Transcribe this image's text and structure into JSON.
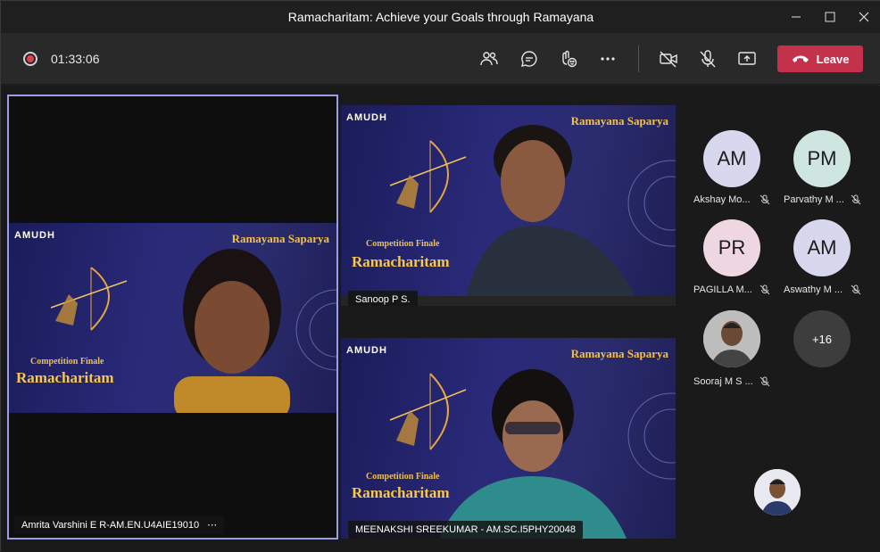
{
  "window": {
    "title": "Ramacharitam: Achieve your Goals through Ramayana"
  },
  "toolbar": {
    "recording_time": "01:33:06",
    "leave_label": "Leave",
    "colors": {
      "leave": "#c4314b",
      "record": "#e0404f"
    }
  },
  "stage": {
    "videos": [
      {
        "participant": "Amrita Varshini E R-AM.EN.U4AIE19010",
        "more": "⋯",
        "brand": "AMUDH",
        "banner": "Ramayana Saparya",
        "subtitle": "Competition Finale",
        "event": "Ramacharitam"
      },
      {
        "participant": "Sanoop P S.",
        "brand": "AMUDH",
        "banner": "Ramayana Saparya",
        "subtitle": "Competition Finale",
        "event": "Ramacharitam"
      },
      {
        "participant": "MEENAKSHI SREEKUMAR - AM.SC.I5PHY20048",
        "brand": "AMUDH",
        "banner": "Ramayana Saparya",
        "subtitle": "Competition Finale",
        "event": "Ramacharitam"
      }
    ]
  },
  "roster": {
    "people": [
      {
        "initials": "AM",
        "name": "Akshay Mo...",
        "color": "#d7d8ed"
      },
      {
        "initials": "PM",
        "name": "Parvathy M ...",
        "color": "#cfe5df"
      },
      {
        "initials": "PR",
        "name": "PAGILLA M...",
        "color": "#efd7e2"
      },
      {
        "initials": "AM",
        "name": "Aswathy M ...",
        "color": "#d7d8ed"
      },
      {
        "initials": "",
        "name": "Sooraj M S ...",
        "color": "#cccccc"
      }
    ],
    "overflow_count": "+16"
  }
}
